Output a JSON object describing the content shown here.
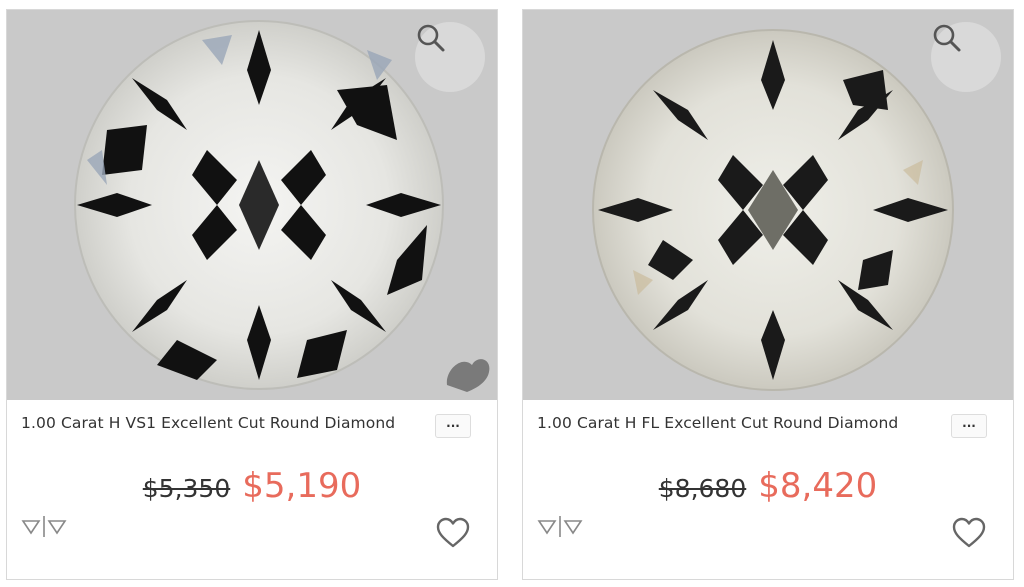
{
  "products": [
    {
      "title": "1.00 Carat H VS1 Excellent Cut Round Diamond",
      "old_price": "$5,350",
      "new_price": "$5,190",
      "icons": {
        "zoom": "magnifier-icon",
        "more": "ellipsis-icon",
        "favorite": "heart-icon",
        "brand": "diamond-logo-icon",
        "badge": "heart-badge-icon"
      }
    },
    {
      "title": "1.00 Carat H FL Excellent Cut Round Diamond",
      "old_price": "$8,680",
      "new_price": "$8,420",
      "icons": {
        "zoom": "magnifier-icon",
        "more": "ellipsis-icon",
        "favorite": "heart-icon",
        "brand": "diamond-logo-icon"
      }
    }
  ],
  "more_label": "···",
  "colors": {
    "sale": "#e86b5c",
    "image_bg": "#c9c9c9",
    "border": "#d8d8d8"
  }
}
